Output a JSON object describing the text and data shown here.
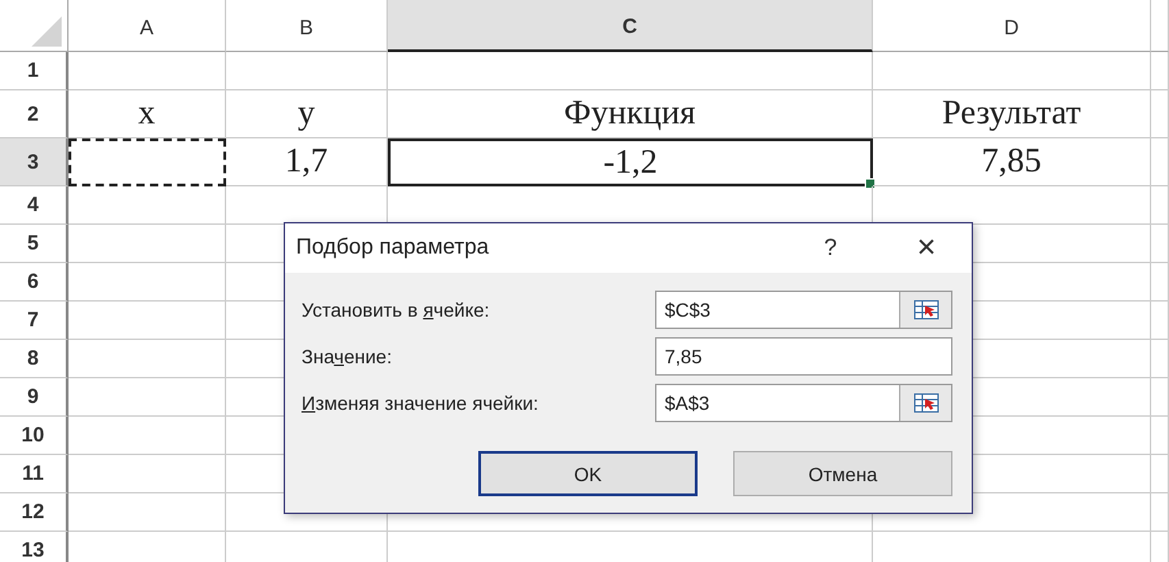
{
  "columns": [
    {
      "label": "A",
      "selected": false
    },
    {
      "label": "B",
      "selected": false
    },
    {
      "label": "C",
      "selected": true
    },
    {
      "label": "D",
      "selected": false
    }
  ],
  "rows": [
    {
      "label": "1",
      "selected": false
    },
    {
      "label": "2",
      "selected": false,
      "cells": [
        {
          "text": "x",
          "active": false,
          "marquee": false
        },
        {
          "text": "y",
          "active": false,
          "marquee": false
        },
        {
          "text": "Функция",
          "active": false,
          "marquee": false
        },
        {
          "text": "Результат",
          "active": false,
          "marquee": false
        }
      ]
    },
    {
      "label": "3",
      "selected": true,
      "cells": [
        {
          "active": false,
          "marquee": true
        },
        {
          "text": "1,7",
          "active": false,
          "marquee": false
        },
        {
          "text": "-1,2",
          "active": true,
          "marquee": false
        },
        {
          "text": "7,85",
          "active": false,
          "marquee": false
        }
      ]
    },
    {
      "label": "4",
      "selected": false
    },
    {
      "label": "5",
      "selected": false
    },
    {
      "label": "6",
      "selected": false
    },
    {
      "label": "7",
      "selected": false
    },
    {
      "label": "8",
      "selected": false
    },
    {
      "label": "9",
      "selected": false
    },
    {
      "label": "10",
      "selected": false
    },
    {
      "label": "11",
      "selected": false
    },
    {
      "label": "12",
      "selected": false
    },
    {
      "label": "13",
      "selected": false
    }
  ],
  "dialog": {
    "title": "Подбор параметра",
    "help": "?",
    "close": "×",
    "fields": [
      {
        "label_before": "Установить в ",
        "access_key": "я",
        "label_after": "чейке:",
        "value": "$C$3",
        "kind": "reference"
      },
      {
        "label_before": "Зна",
        "access_key": "ч",
        "label_after": "ение:",
        "value": "7,85",
        "kind": "text"
      },
      {
        "access_key": "И",
        "label_after": "зменяя значение ячейки:",
        "value": "$A$3",
        "kind": "reference"
      }
    ],
    "buttons": [
      {
        "label": "OK",
        "default": true
      },
      {
        "label": "Отмена",
        "default": false
      }
    ]
  }
}
